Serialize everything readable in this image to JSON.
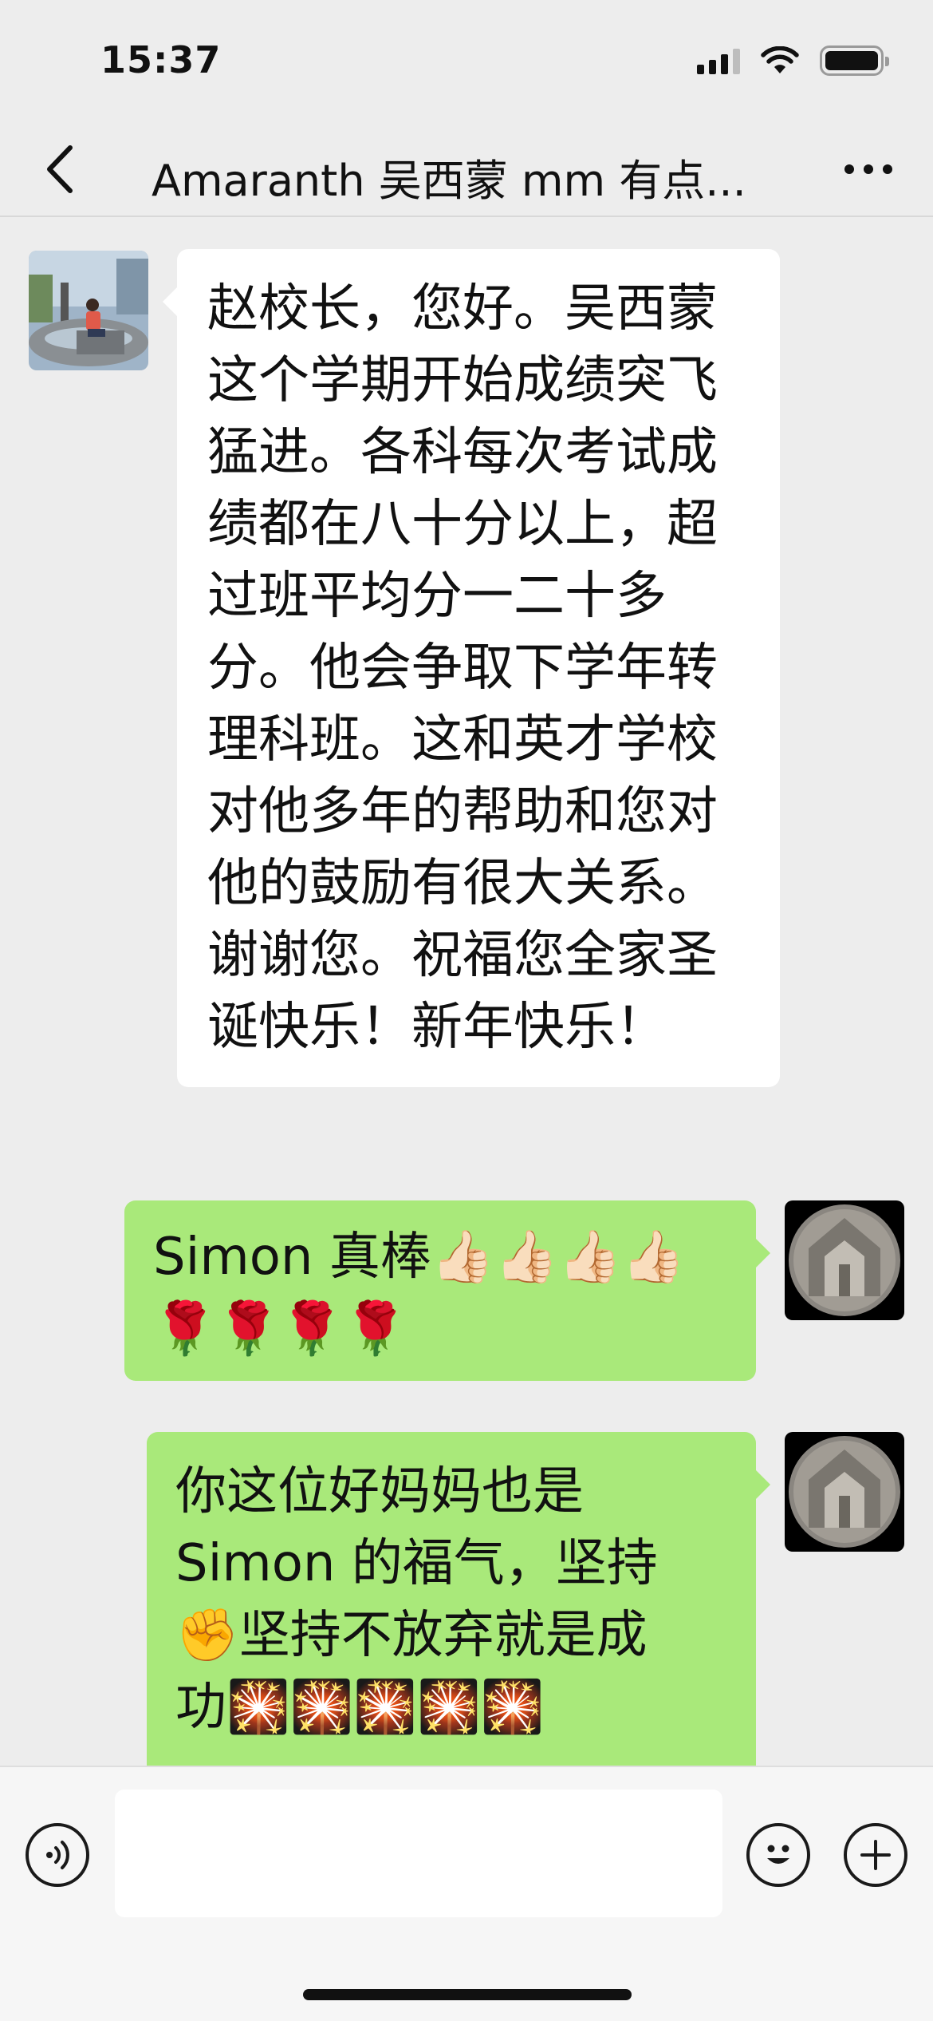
{
  "status_bar": {
    "time": "15:37",
    "icons": [
      "cellular-signal-icon",
      "wifi-icon",
      "battery-icon"
    ]
  },
  "header": {
    "back_icon": "chevron-left-icon",
    "title": "Amaranth 吴西蒙 mm 有点...",
    "more_icon": "more-dots-icon"
  },
  "messages": [
    {
      "sender": "other",
      "avatar": "photo-avatar-woman-by-fountain",
      "text": "赵校长，您好。吴西蒙这个学期开始成绩突飞猛进。各科每次考试成绩都在八十分以上，超过班平均分一二十多分。他会争取下学年转理科班。这和英才学校对他多年的帮助和您对他的鼓励有很大关系。谢谢您。祝福您全家圣诞快乐！新年快乐！"
    },
    {
      "sender": "me",
      "avatar": "medal-avatar",
      "text": "Simon 真棒👍🏻👍🏻👍🏻👍🏻\n🌹🌹🌹🌹"
    },
    {
      "sender": "me",
      "avatar": "medal-avatar",
      "text": "你这位好妈妈也是\nSimon 的福气，坚持\n✊坚持不放弃就是成\n功🎇🎇🎇🎇🎇"
    }
  ],
  "input_bar": {
    "voice_icon": "voice-icon",
    "input_value": "",
    "emoji_icon": "emoji-smiley-icon",
    "plus_icon": "plus-circle-icon"
  },
  "colors": {
    "background": "#ededed",
    "bubble_incoming": "#ffffff",
    "bubble_outgoing": "#a9e97a"
  }
}
